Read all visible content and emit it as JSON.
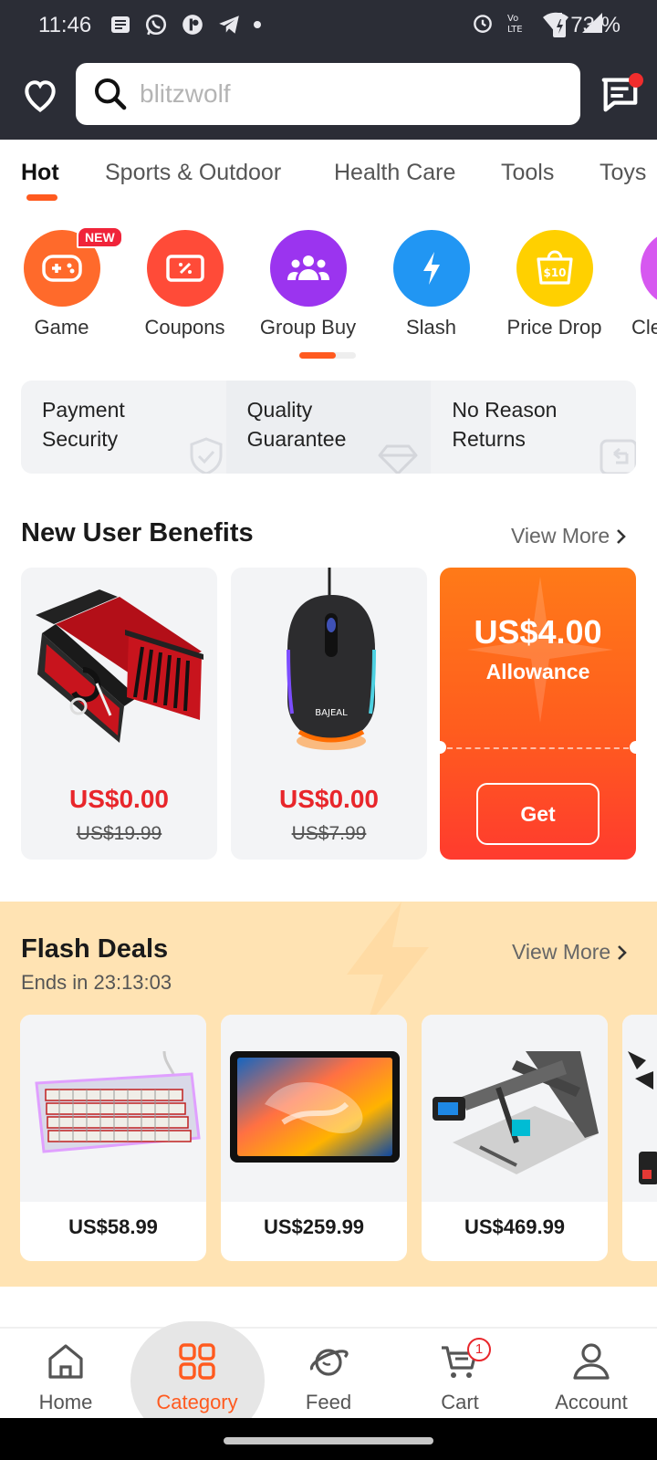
{
  "status_bar": {
    "time": "11:46",
    "battery": "73 %"
  },
  "search": {
    "placeholder": "blitzwolf"
  },
  "tabs": [
    "Hot",
    "Sports & Outdoor",
    "Health Care",
    "Tools",
    "Toys"
  ],
  "categories": [
    {
      "label": "Game",
      "icon": "gamepad-icon",
      "color": "#ff6a2b",
      "badge": "NEW"
    },
    {
      "label": "Coupons",
      "icon": "coupon-icon",
      "color": "#ff4b38"
    },
    {
      "label": "Group Buy",
      "icon": "group-icon",
      "color": "#9b34ef"
    },
    {
      "label": "Slash",
      "icon": "lightning-icon",
      "color": "#2196f3"
    },
    {
      "label": "Price Drop",
      "icon": "price-tag-icon",
      "color": "#ffd000",
      "icon_text": "$10"
    },
    {
      "label": "Cle",
      "icon": "clearance-icon",
      "color": "#d658f0"
    }
  ],
  "guarantees": [
    {
      "line1": "Payment",
      "line2": "Security",
      "icon": "shield-check-icon"
    },
    {
      "line1": "Quality",
      "line2": "Guarantee",
      "icon": "diamond-icon"
    },
    {
      "line1": "No Reason",
      "line2": "Returns",
      "icon": "return-icon"
    }
  ],
  "new_user": {
    "title": "New User Benefits",
    "view_more": "View More",
    "products": [
      {
        "name": "manicure-set",
        "price": "US$0.00",
        "old_price": "US$19.99"
      },
      {
        "name": "gaming-mouse",
        "price": "US$0.00",
        "old_price": "US$7.99",
        "brand": "BAJEAL"
      }
    ],
    "allowance": {
      "amount": "US$4.00",
      "label": "Allowance",
      "button": "Get"
    }
  },
  "flash_deals": {
    "title": "Flash Deals",
    "ends": "Ends in 23:13:03",
    "view_more": "View More",
    "products": [
      {
        "name": "keyboard",
        "price": "US$58.99"
      },
      {
        "name": "tablet",
        "price": "US$259.99"
      },
      {
        "name": "laser-engraver",
        "price": "US$469.99"
      }
    ]
  },
  "bottom_nav": [
    {
      "label": "Home",
      "icon": "home-icon"
    },
    {
      "label": "Category",
      "icon": "category-icon",
      "active": true
    },
    {
      "label": "Feed",
      "icon": "feed-planet-icon"
    },
    {
      "label": "Cart",
      "icon": "cart-icon",
      "badge": "1"
    },
    {
      "label": "Account",
      "icon": "account-icon"
    }
  ],
  "colors": {
    "accent": "#ff5a1f",
    "header_bg": "#2b2d36",
    "price_red": "#e8262b",
    "flash_bg": "#ffe3b3"
  }
}
